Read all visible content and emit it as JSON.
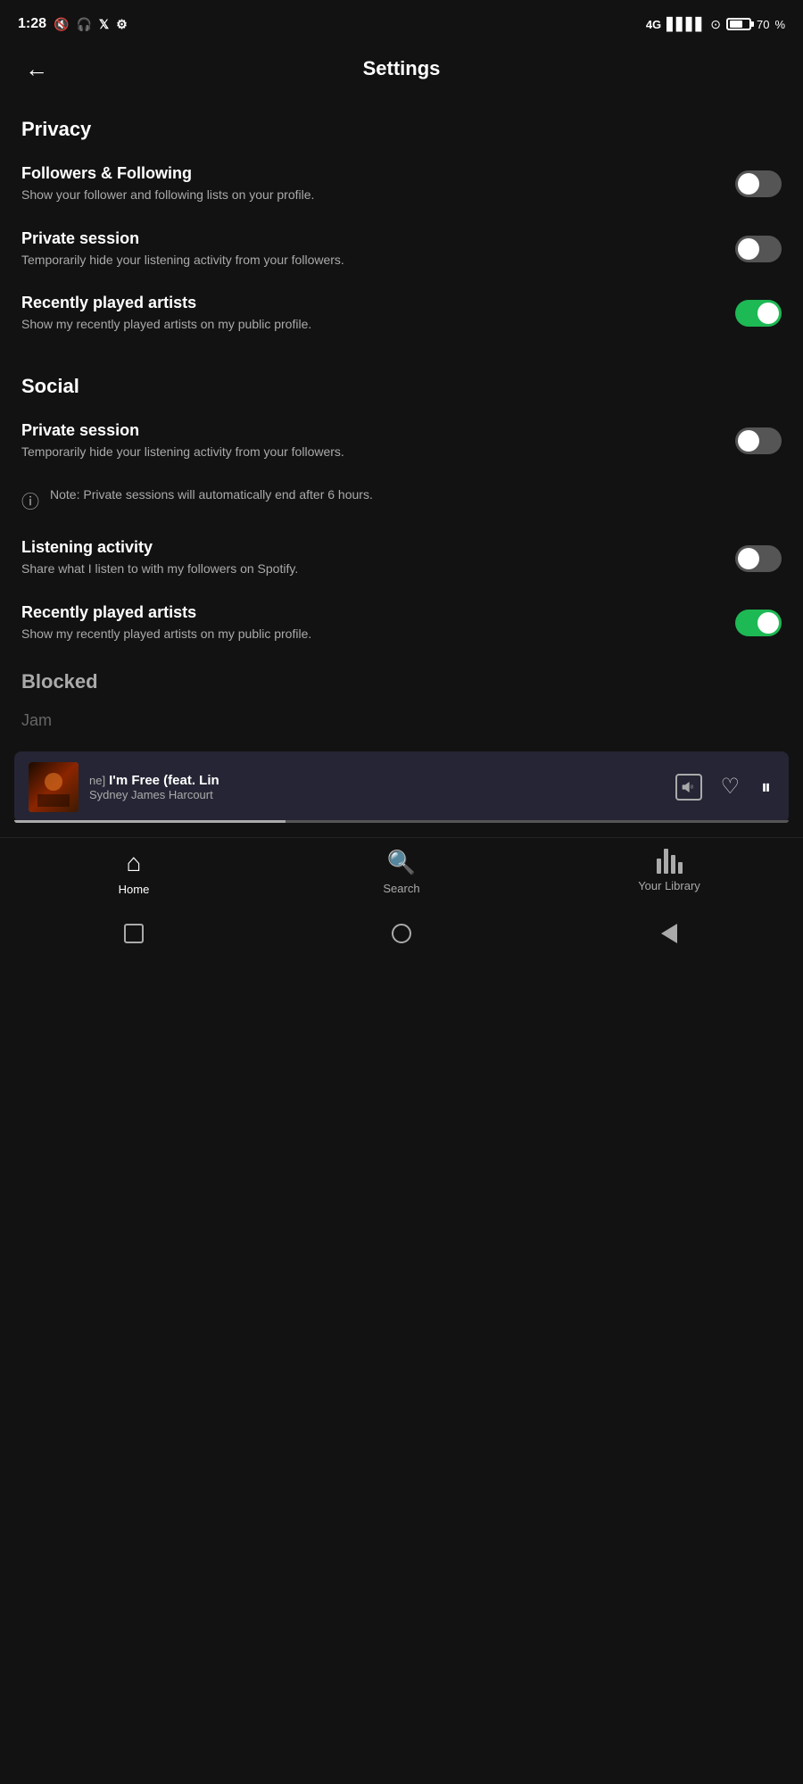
{
  "statusBar": {
    "time": "1:28",
    "batteryPercent": "70"
  },
  "header": {
    "title": "Settings",
    "backLabel": "←"
  },
  "privacy": {
    "sectionLabel": "Privacy",
    "items": [
      {
        "id": "followers-following",
        "title": "Followers & Following",
        "desc": "Show your follower and following lists on your profile.",
        "state": "off"
      },
      {
        "id": "private-session-privacy",
        "title": "Private session",
        "desc": "Temporarily hide your listening activity from your followers.",
        "state": "off"
      },
      {
        "id": "recently-played-artists-privacy",
        "title": "Recently played artists",
        "desc": "Show my recently played artists on my public profile.",
        "state": "on"
      }
    ]
  },
  "social": {
    "sectionLabel": "Social",
    "items": [
      {
        "id": "private-session-social",
        "title": "Private session",
        "desc": "Temporarily hide your listening activity from your followers.",
        "state": "off"
      }
    ],
    "note": "Note: Private sessions will automatically end after 6 hours.",
    "extraItems": [
      {
        "id": "listening-activity",
        "title": "Listening activity",
        "desc": "Share what I listen to with my followers on Spotify.",
        "state": "off"
      },
      {
        "id": "recently-played-artists-social",
        "title": "Recently played artists",
        "desc": "Show my recently played artists on my public profile.",
        "state": "on"
      }
    ]
  },
  "blocked": {
    "partialLabel": "Blocked"
  },
  "nowPlaying": {
    "prefix": "ne]",
    "title": "I'm Free (feat. Lin",
    "artist": "Sydney James Harcourt"
  },
  "jamText": "Jam",
  "bottomNav": {
    "items": [
      {
        "id": "home",
        "label": "Home",
        "active": true
      },
      {
        "id": "search",
        "label": "Search",
        "active": false
      },
      {
        "id": "your-library",
        "label": "Your Library",
        "active": false
      }
    ]
  }
}
